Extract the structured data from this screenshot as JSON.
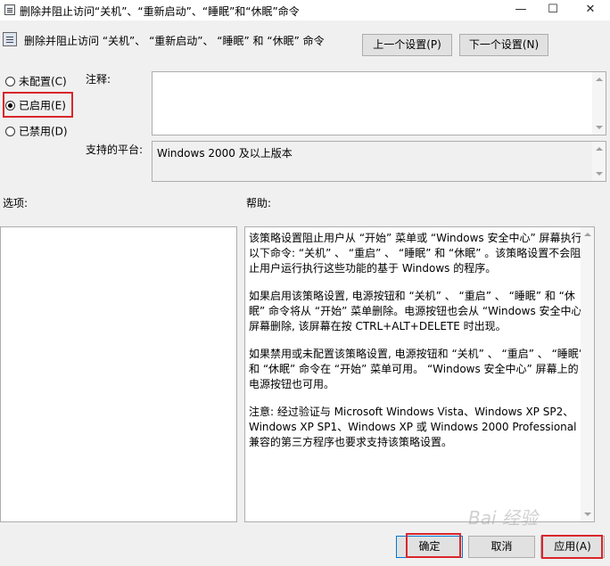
{
  "window": {
    "title": "删除并阻止访问“关机”、“重新启动”、“睡眠”和“休眠”命令",
    "minimize_glyph": "—",
    "maximize_glyph": "☐",
    "close_glyph": "✕"
  },
  "header": {
    "policy_name": "删除并阻止访问 “关机”、 “重新启动”、 “睡眠” 和 “休眠” 命令",
    "prev_label": "上一个设置(P)",
    "next_label": "下一个设置(N)"
  },
  "state": {
    "options": [
      {
        "label": "未配置(C)",
        "checked": false
      },
      {
        "label": "已启用(E)",
        "checked": true
      },
      {
        "label": "已禁用(D)",
        "checked": false
      }
    ]
  },
  "comment": {
    "label": "注释:",
    "value": ""
  },
  "platform": {
    "label": "支持的平台:",
    "value": "Windows 2000 及以上版本"
  },
  "options_section": {
    "label": "选项:"
  },
  "help_section": {
    "label": "帮助:",
    "paragraphs": [
      "该策略设置阻止用户从 “开始” 菜单或 “Windows 安全中心” 屏幕执行以下命令: “关机” 、 “重启” 、 “睡眠” 和 “休眠” 。该策略设置不会阻止用户运行执行这些功能的基于 Windows 的程序。",
      "如果启用该策略设置, 电源按钮和 “关机” 、 “重启” 、 “睡眠” 和 “休眠” 命令将从 “开始” 菜单删除。电源按钮也会从 “Windows 安全中心” 屏幕删除, 该屏幕在按 CTRL+ALT+DELETE 时出现。",
      "如果禁用或未配置该策略设置, 电源按钮和 “关机” 、 “重启” 、 “睡眠” 和 “休眠” 命令在 “开始” 菜单可用。 “Windows 安全中心” 屏幕上的电源按钮也可用。",
      "注意: 经过验证与 Microsoft Windows Vista、Windows XP SP2、Windows XP SP1、Windows XP 或 Windows 2000 Professional 兼容的第三方程序也要求支持该策略设置。"
    ]
  },
  "footer": {
    "ok_label": "确定",
    "cancel_label": "取消",
    "apply_label": "应用(A)"
  },
  "watermark": "Bai 经验",
  "colors": {
    "highlight": "#d9262c",
    "focus": "#0078d7"
  }
}
